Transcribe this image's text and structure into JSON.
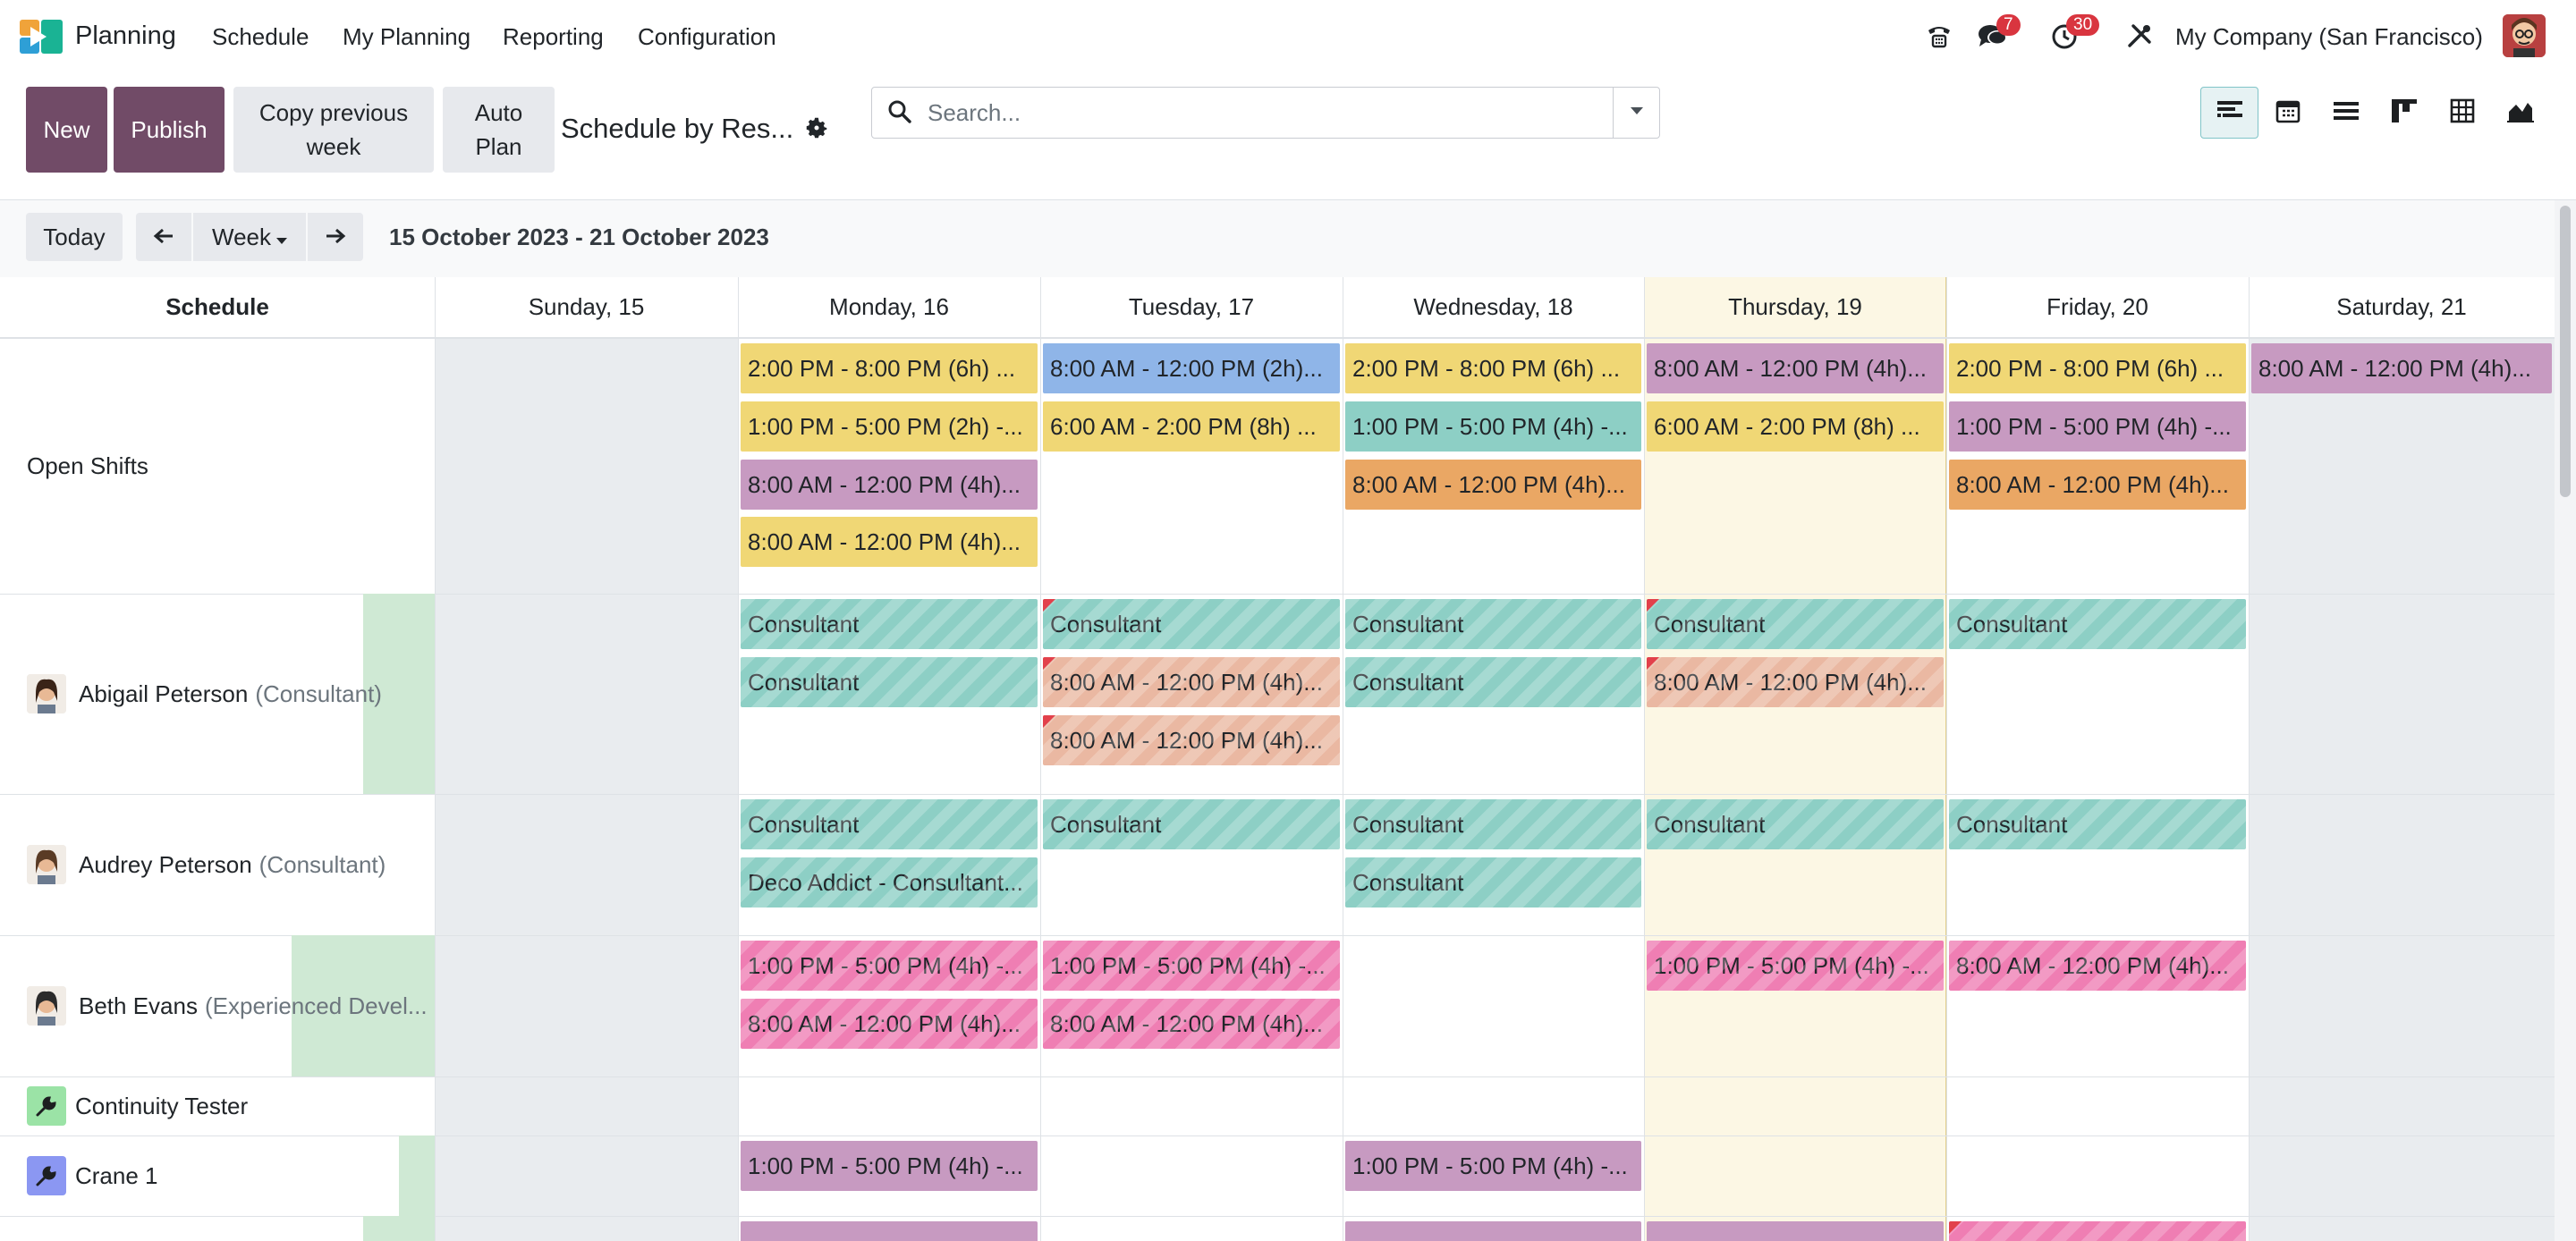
{
  "app": {
    "name": "Planning"
  },
  "menu": [
    "Schedule",
    "My Planning",
    "Reporting",
    "Configuration"
  ],
  "systray": {
    "messages_count": "7",
    "activities_count": "30",
    "company": "My Company (San Francisco)"
  },
  "control": {
    "new_label": "New",
    "publish_label": "Publish",
    "copy_label": "Copy previous week",
    "autoplan_label": "Auto Plan",
    "view_title": "Schedule by Res...",
    "search_placeholder": "Search..."
  },
  "views": [
    "gantt-icon",
    "calendar-icon",
    "list-icon",
    "kanban-icon",
    "pivot-icon",
    "graph-icon"
  ],
  "toolbar": {
    "today": "Today",
    "scale": "Week",
    "range": "15 October 2023 - 21 October 2023"
  },
  "grid": {
    "schedule_header": "Schedule",
    "days": [
      "Sunday, 15",
      "Monday, 16",
      "Tuesday, 17",
      "Wednesday, 18",
      "Thursday, 19",
      "Friday, 20",
      "Saturday, 21"
    ],
    "rows": [
      {
        "name": "Open Shifts",
        "sub": ""
      },
      {
        "name": "Abigail Peterson",
        "sub": "(Consultant)"
      },
      {
        "name": "Audrey Peterson",
        "sub": "(Consultant)"
      },
      {
        "name": "Beth Evans",
        "sub": "(Experienced Devel..."
      },
      {
        "name": "Continuity Tester",
        "sub": ""
      },
      {
        "name": "Crane 1",
        "sub": ""
      }
    ],
    "row_progress": [
      0,
      0.5,
      0,
      1.0,
      0,
      0.25,
      0.5
    ],
    "shifts": [
      {
        "row": 0,
        "day": 1,
        "slot": 0,
        "label": "2:00 PM - 8:00 PM (6h) ...",
        "color": "yellow"
      },
      {
        "row": 0,
        "day": 1,
        "slot": 1,
        "label": "1:00 PM - 5:00 PM (2h) -...",
        "color": "yellow"
      },
      {
        "row": 0,
        "day": 1,
        "slot": 2,
        "label": "8:00 AM - 12:00 PM (4h)...",
        "color": "purple"
      },
      {
        "row": 0,
        "day": 1,
        "slot": 3,
        "label": "8:00 AM - 12:00 PM (4h)...",
        "color": "yellow"
      },
      {
        "row": 0,
        "day": 2,
        "slot": 0,
        "label": "8:00 AM - 12:00 PM (2h)...",
        "color": "blue"
      },
      {
        "row": 0,
        "day": 2,
        "slot": 1,
        "label": "6:00 AM - 2:00 PM (8h) ...",
        "color": "yellow"
      },
      {
        "row": 0,
        "day": 3,
        "slot": 0,
        "label": "2:00 PM - 8:00 PM (6h) ...",
        "color": "yellow"
      },
      {
        "row": 0,
        "day": 3,
        "slot": 1,
        "label": "1:00 PM - 5:00 PM (4h) -...",
        "color": "teal"
      },
      {
        "row": 0,
        "day": 3,
        "slot": 2,
        "label": "8:00 AM - 12:00 PM (4h)...",
        "color": "orange"
      },
      {
        "row": 0,
        "day": 4,
        "slot": 0,
        "label": "8:00 AM - 12:00 PM (4h)...",
        "color": "purple"
      },
      {
        "row": 0,
        "day": 4,
        "slot": 1,
        "label": "6:00 AM - 2:00 PM (8h) ...",
        "color": "yellow"
      },
      {
        "row": 0,
        "day": 5,
        "slot": 0,
        "label": "2:00 PM - 8:00 PM (6h) ...",
        "color": "yellow"
      },
      {
        "row": 0,
        "day": 5,
        "slot": 1,
        "label": "1:00 PM - 5:00 PM (4h) -...",
        "color": "purple"
      },
      {
        "row": 0,
        "day": 5,
        "slot": 2,
        "label": "8:00 AM - 12:00 PM (4h)...",
        "color": "orange"
      },
      {
        "row": 0,
        "day": 6,
        "slot": 0,
        "label": "8:00 AM - 12:00 PM (4h)...",
        "color": "purple"
      },
      {
        "row": 1,
        "day": 1,
        "slot": 0,
        "label": "Consultant",
        "color": "teal",
        "striped": true
      },
      {
        "row": 1,
        "day": 1,
        "slot": 1,
        "label": "Consultant",
        "color": "teal",
        "striped": true
      },
      {
        "row": 1,
        "day": 2,
        "slot": 0,
        "label": "Consultant",
        "color": "teal",
        "striped": true,
        "warn": true
      },
      {
        "row": 1,
        "day": 2,
        "slot": 1,
        "label": "8:00 AM - 12:00 PM (4h)...",
        "color": "salmon",
        "striped": true,
        "warn": true
      },
      {
        "row": 1,
        "day": 2,
        "slot": 2,
        "label": "8:00 AM - 12:00 PM (4h)...",
        "color": "salmon",
        "striped": true,
        "warn": true
      },
      {
        "row": 1,
        "day": 3,
        "slot": 0,
        "label": "Consultant",
        "color": "teal",
        "striped": true
      },
      {
        "row": 1,
        "day": 3,
        "slot": 1,
        "label": "Consultant",
        "color": "teal",
        "striped": true
      },
      {
        "row": 1,
        "day": 4,
        "slot": 0,
        "label": "Consultant",
        "color": "teal",
        "striped": true,
        "warn": true
      },
      {
        "row": 1,
        "day": 4,
        "slot": 1,
        "label": "8:00 AM - 12:00 PM (4h)...",
        "color": "salmon",
        "striped": true,
        "warn": true
      },
      {
        "row": 1,
        "day": 5,
        "slot": 0,
        "label": "Consultant",
        "color": "teal",
        "striped": true
      },
      {
        "row": 2,
        "day": 1,
        "slot": 0,
        "label": "Consultant",
        "color": "teal",
        "striped": true
      },
      {
        "row": 2,
        "day": 1,
        "slot": 1,
        "label": "Deco Addict - Consultant...",
        "color": "teal",
        "striped": true
      },
      {
        "row": 2,
        "day": 2,
        "slot": 0,
        "label": "Consultant",
        "color": "teal",
        "striped": true
      },
      {
        "row": 2,
        "day": 3,
        "slot": 0,
        "label": "Consultant",
        "color": "teal",
        "striped": true
      },
      {
        "row": 2,
        "day": 3,
        "slot": 1,
        "label": "Consultant",
        "color": "teal",
        "striped": true
      },
      {
        "row": 2,
        "day": 4,
        "slot": 0,
        "label": "Consultant",
        "color": "teal",
        "striped": true
      },
      {
        "row": 2,
        "day": 5,
        "slot": 0,
        "label": "Consultant",
        "color": "teal",
        "striped": true
      },
      {
        "row": 3,
        "day": 1,
        "slot": 0,
        "label": "1:00 PM - 5:00 PM (4h) -...",
        "color": "pink",
        "striped": true
      },
      {
        "row": 3,
        "day": 1,
        "slot": 1,
        "label": "8:00 AM - 12:00 PM (4h)...",
        "color": "pink",
        "striped": true
      },
      {
        "row": 3,
        "day": 2,
        "slot": 0,
        "label": "1:00 PM - 5:00 PM (4h) -...",
        "color": "pink",
        "striped": true
      },
      {
        "row": 3,
        "day": 2,
        "slot": 1,
        "label": "8:00 AM - 12:00 PM (4h)...",
        "color": "pink",
        "striped": true
      },
      {
        "row": 3,
        "day": 4,
        "slot": 0,
        "label": "1:00 PM - 5:00 PM (4h) -...",
        "color": "pink",
        "striped": true
      },
      {
        "row": 3,
        "day": 5,
        "slot": 0,
        "label": "8:00 AM - 12:00 PM (4h)...",
        "color": "pink",
        "striped": true
      },
      {
        "row": 5,
        "day": 1,
        "slot": 0,
        "label": "1:00 PM - 5:00 PM (4h) -...",
        "color": "purple"
      },
      {
        "row": 5,
        "day": 3,
        "slot": 0,
        "label": "1:00 PM - 5:00 PM (4h) -...",
        "color": "purple"
      }
    ]
  }
}
